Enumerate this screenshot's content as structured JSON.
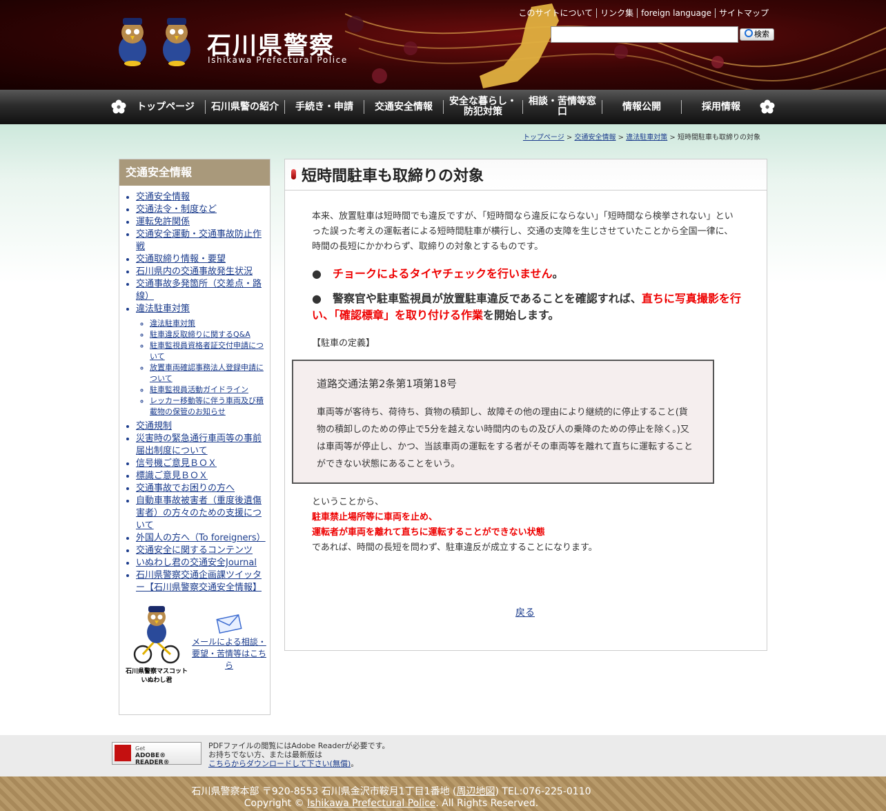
{
  "header": {
    "logo_jp": "石川県警察",
    "logo_en": "Ishikawa Prefectural Police",
    "top_links": [
      "このサイトについて",
      "リンク集",
      "foreign language",
      "サイトマップ"
    ],
    "search": {
      "placeholder": "",
      "button_label": "検索"
    }
  },
  "nav": {
    "items": [
      "トップページ",
      "石川県警の紹介",
      "手続き・申請",
      "交通安全情報",
      "安全な暮らし・防犯対策",
      "相談・苦情等窓口",
      "情報公開",
      "採用情報"
    ]
  },
  "breadcrumb": {
    "items": [
      "トップページ",
      "交通安全情報",
      "違法駐車対策"
    ],
    "current": "短時間駐車も取締りの対象"
  },
  "sidebar": {
    "title": "交通安全情報",
    "items": [
      "交通安全情報",
      "交通法令・制度など",
      "運転免許関係",
      "交通安全運動・交通事故防止作戦",
      "交通取締り情報・要望",
      "石川県内の交通事故発生状況",
      "交通事故多発箇所（交差点・路線）",
      "違法駐車対策"
    ],
    "sub_items": [
      "違法駐車対策",
      "駐車違反取締りに関するQ&A",
      "駐車監視員資格者証交付申請について",
      "放置車両確認事務法人登録申請について",
      "駐車監視員活動ガイドライン",
      "レッカー移動等に伴う車両及び積載物の保管のお知らせ"
    ],
    "items_after": [
      "交通規制",
      "災害時の緊急通行車両等の事前届出制度について",
      "信号機ご意見ＢＯＸ",
      "標識ご意見ＢＯＸ",
      "交通事故でお困りの方へ",
      "自動車事故被害者（重度後遺傷害者）の方々のための支援について",
      "外国人の方へ（To foreigners）",
      "交通安全に関するコンテンツ",
      "いぬわし君の交通安全Journal",
      "石川県警察交通企画課ツイッター【石川県警察交通安全情報】"
    ],
    "mascot_caption_1": "石川県警察マスコット",
    "mascot_caption_2": "いぬわし君",
    "mail_link": "メールによる相談・要望・苦情等はこちら"
  },
  "main": {
    "title": "短時間駐車も取締りの対象",
    "intro": "本来、放置駐車は短時間でも違反ですが、「短時間なら違反にならない」「短時間なら検挙されない」といった誤った考えの運転者による短時間駐車が横行し、交通の支障を生じさせていたことから全国一律に、時間の長短にかかわらず、取締りの対象とするものです。",
    "bullet1_red": "チョークによるタイヤチェックを行いません",
    "bullet1_end": "。",
    "bullet2_a": "警察官や駐車監視員が放置駐車違反であることを確認すれば、",
    "bullet2_red": "直ちに写真撮影を行い、「確認標章」を取り付ける作業",
    "bullet2_b": "を開始します。",
    "definition_label": "【駐車の定義】",
    "definition_title": "道路交通法第2条第1項第18号",
    "definition_body": "車両等が客待ち、荷待ち、貨物の積卸し、故障その他の理由により継続的に停止すること(貨物の積卸しのための停止で5分を越えない時間内のもの及び人の乗降のための停止を除く。)又は車両等が停止し、かつ、当該車両の運転をする者がその車両等を離れて直ちに運転することができない状態にあることをいう。",
    "conclusion_1": "ということから、",
    "conclusion_red_1": "駐車禁止場所等に車両を止め、",
    "conclusion_red_2": "運転者が車両を離れて直ちに運転することができない状態",
    "conclusion_2": "であれば、時間の長短を問わず、駐車違反が成立することになります。",
    "back_link": "戻る"
  },
  "pdf": {
    "badge_get": "Get",
    "badge_name": "ADOBE® READER®",
    "line1": "PDFファイルの閲覧にはAdobe Readerが必要です。",
    "line2": "お持ちでない方、または最新版は",
    "link": "こちらからダウンロードして下さい(無償)",
    "line3_end": "。"
  },
  "footer": {
    "address_a": "石川県警察本部 〒920-8553 石川県金沢市鞍月1丁目1番地 (",
    "map_link": "周辺地図",
    "address_b": ") TEL:076-225-0110",
    "copyright_a": "Copyright © ",
    "copyright_link": "Ishikawa Prefectural Police",
    "copyright_b": ". All Rights Reserved."
  },
  "colors": {
    "accent_red": "#e00000",
    "sidebar_head": "#a9997b",
    "header_dark": "#3a0505"
  }
}
